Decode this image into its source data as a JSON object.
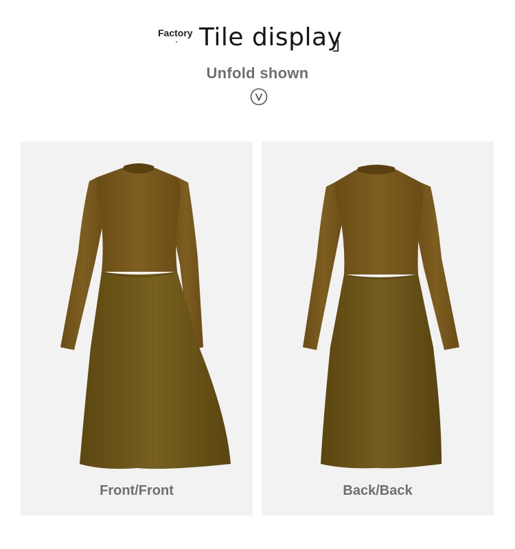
{
  "header": {
    "factory_label": "Factory",
    "title": "Tile display",
    "bracket": "」",
    "subtitle": "Unfold shown",
    "chevron_icon": "chevron-down-circle-icon"
  },
  "panels": [
    {
      "label": "Front/Front",
      "image": "dress-front-image"
    },
    {
      "label": "Back/Back",
      "image": "dress-back-image"
    }
  ],
  "colors": {
    "panel_bg": "#f2f2f2",
    "dress_top": "#7a5a1c",
    "dress_skirt": "#6e561a",
    "label_gray": "#6e6e6e"
  }
}
